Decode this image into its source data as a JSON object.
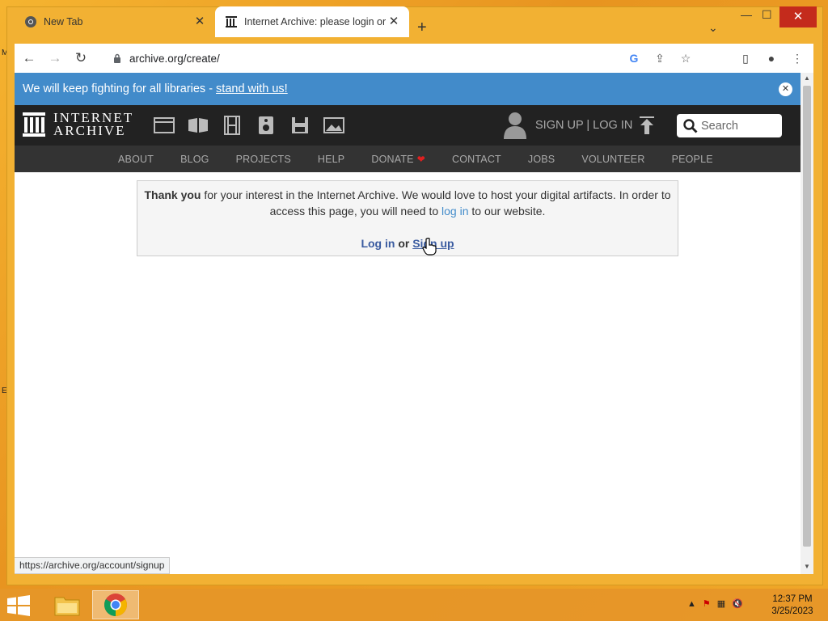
{
  "browser": {
    "tabs": [
      {
        "title": "New Tab",
        "active": false
      },
      {
        "title": "Internet Archive: please login or sign up",
        "active": true
      }
    ],
    "new_tab_label": "+",
    "url": "archive.org/create/",
    "status_url": "https://archive.org/account/signup"
  },
  "banner": {
    "text": "We will keep fighting for all libraries -",
    "link": "stand with us!"
  },
  "header": {
    "logo_line1": "INTERNET",
    "logo_line2": "ARCHIVE",
    "signin_text": "SIGN UP | LOG IN",
    "search_placeholder": "Search"
  },
  "nav": [
    "ABOUT",
    "BLOG",
    "PROJECTS",
    "HELP",
    "DONATE",
    "CONTACT",
    "JOBS",
    "VOLUNTEER",
    "PEOPLE"
  ],
  "notice": {
    "bold": "Thank you",
    "text1": " for your interest in the Internet Archive. We would love to host your digital artifacts. In order to access this page, you will need to ",
    "link": "log in",
    "text2": " to our website.",
    "login_label": "Log in",
    "or_label": "or",
    "signup_label": "Sign up"
  },
  "taskbar": {
    "time": "12:37 PM",
    "date": "3/25/2023"
  },
  "colors": {
    "banner": "#428bca",
    "header": "#222222",
    "nav": "#333333"
  }
}
